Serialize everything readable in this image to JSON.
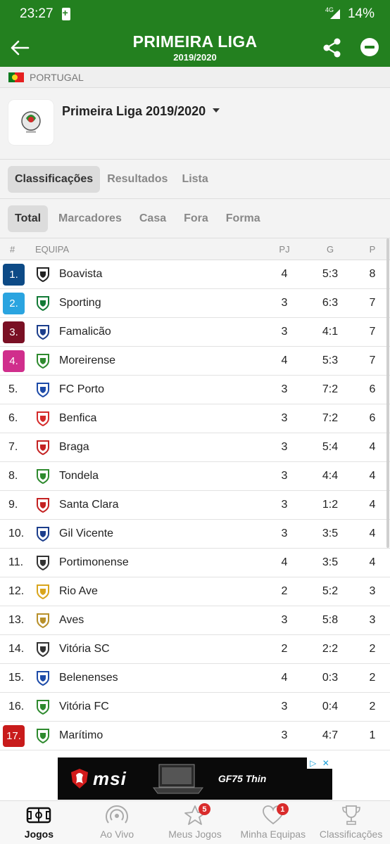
{
  "status": {
    "time": "23:27",
    "network": "4G",
    "battery": "14%"
  },
  "header": {
    "title": "PRIMEIRA LIGA",
    "subtitle": "2019/2020"
  },
  "country": {
    "name": "PORTUGAL"
  },
  "league": {
    "name": "Primeira Liga 2019/2020"
  },
  "tabs": [
    {
      "label": "Classificações",
      "active": true
    },
    {
      "label": "Resultados",
      "active": false
    },
    {
      "label": "Lista",
      "active": false
    }
  ],
  "subtabs": [
    {
      "label": "Total",
      "active": true
    },
    {
      "label": "Marcadores",
      "active": false
    },
    {
      "label": "Casa",
      "active": false
    },
    {
      "label": "Fora",
      "active": false
    },
    {
      "label": "Forma",
      "active": false
    }
  ],
  "table": {
    "headers": {
      "pos": "#",
      "team": "EQUIPA",
      "pj": "PJ",
      "g": "G",
      "p": "P"
    },
    "rows": [
      {
        "pos": "1.",
        "team": "Boavista",
        "pj": "4",
        "g": "5:3",
        "p": "8",
        "badge": "#0d4a86",
        "crest": "#222"
      },
      {
        "pos": "2.",
        "team": "Sporting",
        "pj": "3",
        "g": "6:3",
        "p": "7",
        "badge": "#2aa4e0",
        "crest": "#127a36"
      },
      {
        "pos": "3.",
        "team": "Famalicão",
        "pj": "3",
        "g": "4:1",
        "p": "7",
        "badge": "#7a1024",
        "crest": "#1c3e8c"
      },
      {
        "pos": "4.",
        "team": "Moreirense",
        "pj": "4",
        "g": "5:3",
        "p": "7",
        "badge": "#d02e8c",
        "crest": "#2e8a2e"
      },
      {
        "pos": "5.",
        "team": "FC Porto",
        "pj": "3",
        "g": "7:2",
        "p": "6",
        "badge": "",
        "crest": "#1c4aa8"
      },
      {
        "pos": "6.",
        "team": "Benfica",
        "pj": "3",
        "g": "7:2",
        "p": "6",
        "badge": "",
        "crest": "#d42a2a"
      },
      {
        "pos": "7.",
        "team": "Braga",
        "pj": "3",
        "g": "5:4",
        "p": "4",
        "badge": "",
        "crest": "#c42222"
      },
      {
        "pos": "8.",
        "team": "Tondela",
        "pj": "3",
        "g": "4:4",
        "p": "4",
        "badge": "",
        "crest": "#2e8a2e"
      },
      {
        "pos": "9.",
        "team": "Santa Clara",
        "pj": "3",
        "g": "1:2",
        "p": "4",
        "badge": "",
        "crest": "#c42222"
      },
      {
        "pos": "10.",
        "team": "Gil Vicente",
        "pj": "3",
        "g": "3:5",
        "p": "4",
        "badge": "",
        "crest": "#1c3e8c"
      },
      {
        "pos": "11.",
        "team": "Portimonense",
        "pj": "4",
        "g": "3:5",
        "p": "4",
        "badge": "",
        "crest": "#333"
      },
      {
        "pos": "12.",
        "team": "Rio Ave",
        "pj": "2",
        "g": "5:2",
        "p": "3",
        "badge": "",
        "crest": "#d9a51c"
      },
      {
        "pos": "13.",
        "team": "Aves",
        "pj": "3",
        "g": "5:8",
        "p": "3",
        "badge": "",
        "crest": "#b8902a"
      },
      {
        "pos": "14.",
        "team": "Vitória SC",
        "pj": "2",
        "g": "2:2",
        "p": "2",
        "badge": "",
        "crest": "#333"
      },
      {
        "pos": "15.",
        "team": "Belenenses",
        "pj": "4",
        "g": "0:3",
        "p": "2",
        "badge": "",
        "crest": "#1c4aa8"
      },
      {
        "pos": "16.",
        "team": "Vitória FC",
        "pj": "3",
        "g": "0:4",
        "p": "2",
        "badge": "",
        "crest": "#2e8a2e"
      },
      {
        "pos": "17.",
        "team": "Marítimo",
        "pj": "3",
        "g": "4:7",
        "p": "1",
        "badge": "#c81b1b",
        "crest": "#2e8a2e"
      }
    ]
  },
  "ad": {
    "brand": "msi",
    "model": "GF75 Thin"
  },
  "bottomnav": [
    {
      "label": "Jogos",
      "active": true,
      "badge": ""
    },
    {
      "label": "Ao Vivo",
      "active": false,
      "badge": ""
    },
    {
      "label": "Meus Jogos",
      "active": false,
      "badge": "5"
    },
    {
      "label": "Minha Equipas",
      "active": false,
      "badge": "1"
    },
    {
      "label": "Classificações",
      "active": false,
      "badge": ""
    }
  ],
  "colors": {
    "primary": "#23801f",
    "badge": "#d92b2b"
  }
}
